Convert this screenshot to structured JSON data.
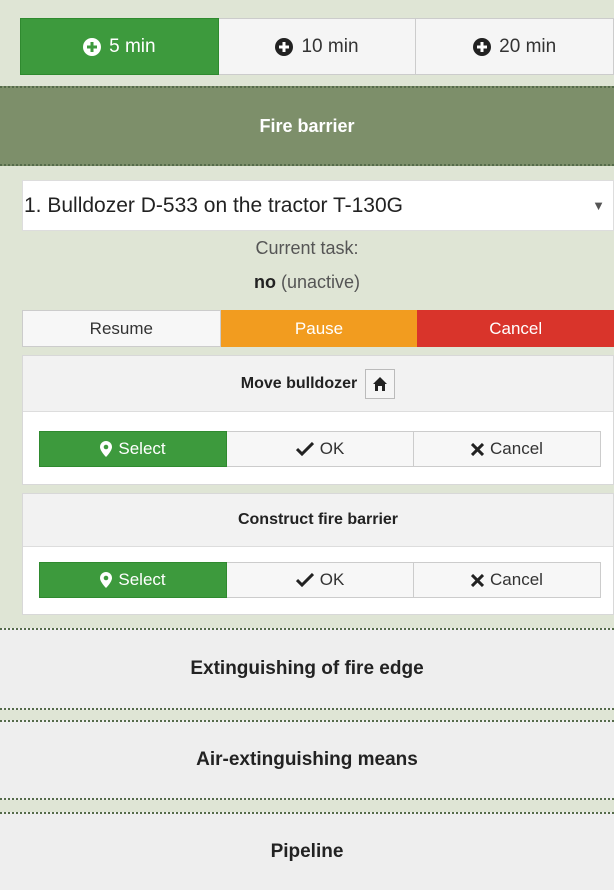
{
  "time_options": {
    "opt1": "5 min",
    "opt2": "10 min",
    "opt3": "20 min"
  },
  "fire_barrier": {
    "header": "Fire barrier",
    "vehicle_select": "1. Bulldozer D-533 on the tractor T-130G",
    "current_task_label": "Current task:",
    "current_task_value": "no",
    "current_task_state": "(unactive)",
    "controls": {
      "resume": "Resume",
      "pause": "Pause",
      "cancel": "Cancel"
    },
    "move_card": {
      "title": "Move bulldozer",
      "select": "Select",
      "ok": "OK",
      "cancel": "Cancel"
    },
    "construct_card": {
      "title": "Construct fire barrier",
      "select": "Select",
      "ok": "OK",
      "cancel": "Cancel"
    }
  },
  "sections": {
    "extinguishing": "Extinguishing of fire edge",
    "air": "Air-extinguishing means",
    "pipeline": "Pipeline"
  },
  "colors": {
    "green": "#3d9a3d",
    "orange": "#f29c1f",
    "red": "#d9342b",
    "header_olive": "#7d8f6a"
  },
  "icons": {
    "time": "plus-circle-icon",
    "home": "home-icon",
    "select": "map-marker-icon",
    "ok": "check-icon",
    "cancel": "times-icon"
  }
}
